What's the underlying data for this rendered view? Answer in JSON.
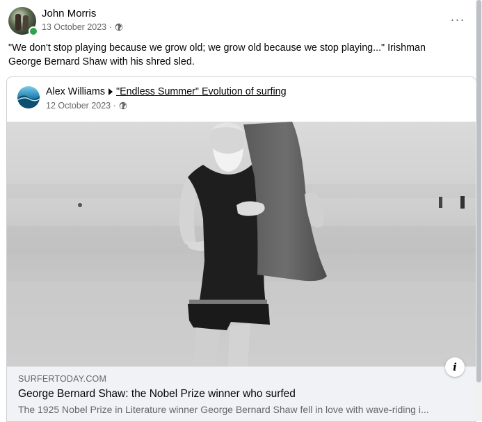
{
  "post": {
    "author": "John Morris",
    "date": "13 October 2023 ·",
    "caption": "\"We don't stop playing because we grow old; we grow old because we stop playing...\" Irishman George Bernard Shaw with his shred sled.",
    "more_label": "···"
  },
  "shared_post": {
    "author": "Alex Williams",
    "group": "\"Endless Summer\" Evolution of surfing",
    "date": "12 October 2023 ·"
  },
  "link_preview": {
    "domain": "SURFERTODAY.COM",
    "title": "George Bernard Shaw: the Nobel Prize winner who surfed",
    "description": "The 1925 Nobel Prize in Literature winner George Bernard Shaw fell in love with wave-riding i...",
    "info_label": "i"
  },
  "icons": {
    "privacy": "globe-icon",
    "more": "more-options-icon",
    "info": "info-icon",
    "arrow": "right-triangle-icon"
  },
  "colors": {
    "online": "#31a24c",
    "secondary_text": "#65676b",
    "link_bg": "#f0f2f5"
  }
}
